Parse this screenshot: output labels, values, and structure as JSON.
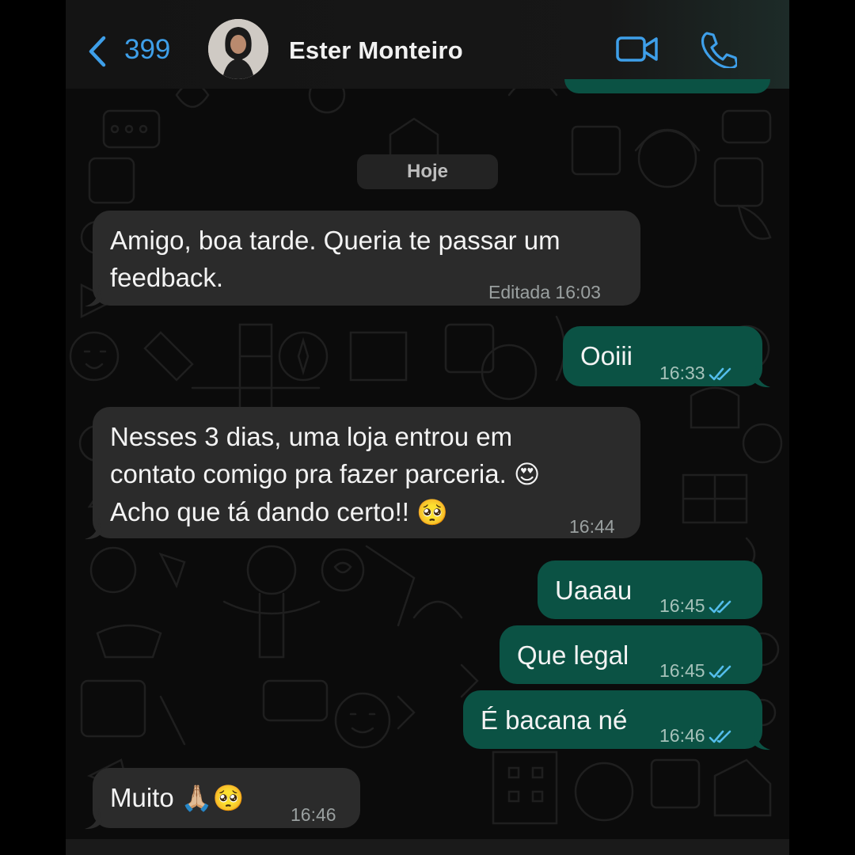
{
  "header": {
    "back_count": "399",
    "contact_name": "Ester Monteiro"
  },
  "date_divider": "Hoje",
  "messages": [
    {
      "direction": "in",
      "line1": "Amigo, boa tarde. Queria te passar um",
      "line2": "feedback.",
      "edited_label": "Editada",
      "time": "16:03"
    },
    {
      "direction": "out",
      "text": "Ooiii",
      "time": "16:33",
      "status": "read"
    },
    {
      "direction": "in",
      "line1": "Nesses 3 dias, uma loja entrou em",
      "line2": "contato comigo pra fazer parceria.",
      "line2_emoji": "😍",
      "line3": "Acho que tá dando certo!!",
      "line3_emoji": "🥺",
      "time": "16:44"
    },
    {
      "direction": "out",
      "text": "Uaaau",
      "time": "16:45",
      "status": "read"
    },
    {
      "direction": "out",
      "text": "Que legal",
      "time": "16:45",
      "status": "read"
    },
    {
      "direction": "out",
      "text": "É bacana né",
      "time": "16:46",
      "status": "read"
    },
    {
      "direction": "in",
      "text": "Muito",
      "emoji": "🙏🏼🥺",
      "time": "16:46"
    }
  ],
  "colors": {
    "accent": "#3e9fe9",
    "incoming_bubble": "#2b2b2b",
    "outgoing_bubble": "#0b5244",
    "read_ticks": "#53bdeb"
  }
}
